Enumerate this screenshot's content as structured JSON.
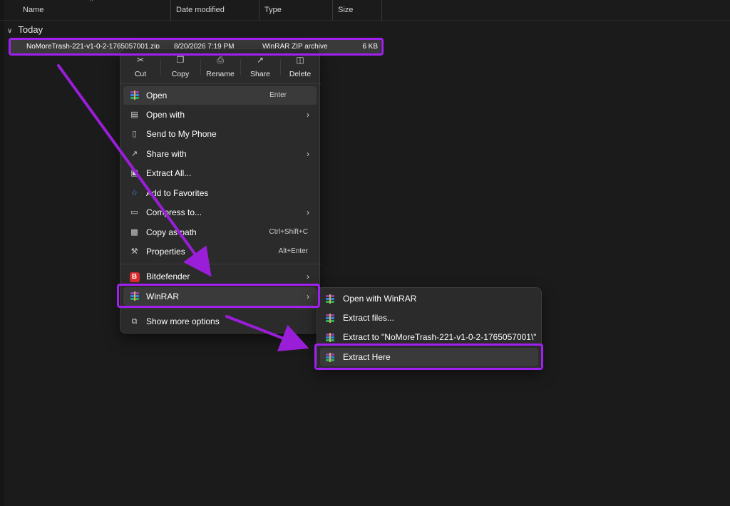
{
  "columns": {
    "name": "Name",
    "date": "Date modified",
    "type": "Type",
    "size": "Size"
  },
  "group": {
    "label": "Today"
  },
  "file": {
    "name": "NoMoreTrash-221-v1-0-2-1765057001.zip",
    "date": "8/20/2026 7:19 PM",
    "type": "WinRAR ZIP archive",
    "size": "6 KB"
  },
  "toolbar": {
    "cut": "Cut",
    "copy": "Copy",
    "rename": "Rename",
    "share": "Share",
    "delete": "Delete"
  },
  "menu": {
    "open": "Open",
    "open_shortcut": "Enter",
    "open_with": "Open with",
    "send_to_phone": "Send to My Phone",
    "share_with": "Share with",
    "extract_all": "Extract All...",
    "add_favorites": "Add to Favorites",
    "compress": "Compress to...",
    "copy_path": "Copy as path",
    "copy_path_shortcut": "Ctrl+Shift+C",
    "properties": "Properties",
    "properties_shortcut": "Alt+Enter",
    "bitdefender": "Bitdefender",
    "bitdefender_badge": "B",
    "winrar": "WinRAR",
    "show_more": "Show more options"
  },
  "submenu": {
    "open_with_winrar": "Open with WinRAR",
    "extract_files": "Extract files...",
    "extract_to": "Extract to \"NoMoreTrash-221-v1-0-2-1765057001\\\"",
    "extract_here": "Extract Here"
  },
  "colors": {
    "highlight": "#a020f0",
    "arrow": "#9a1ed8",
    "background": "#1b1b1b",
    "menu": "#2b2b2b"
  },
  "icons": [
    "scissors-icon",
    "copy-icon",
    "rename-icon",
    "share-icon",
    "trash-icon",
    "winrar-icon",
    "open-with-icon",
    "phone-icon",
    "extract-icon",
    "star-icon",
    "compress-icon",
    "path-icon",
    "wrench-icon",
    "bitdefender-icon",
    "more-options-icon",
    "chevron-right-icon"
  ]
}
